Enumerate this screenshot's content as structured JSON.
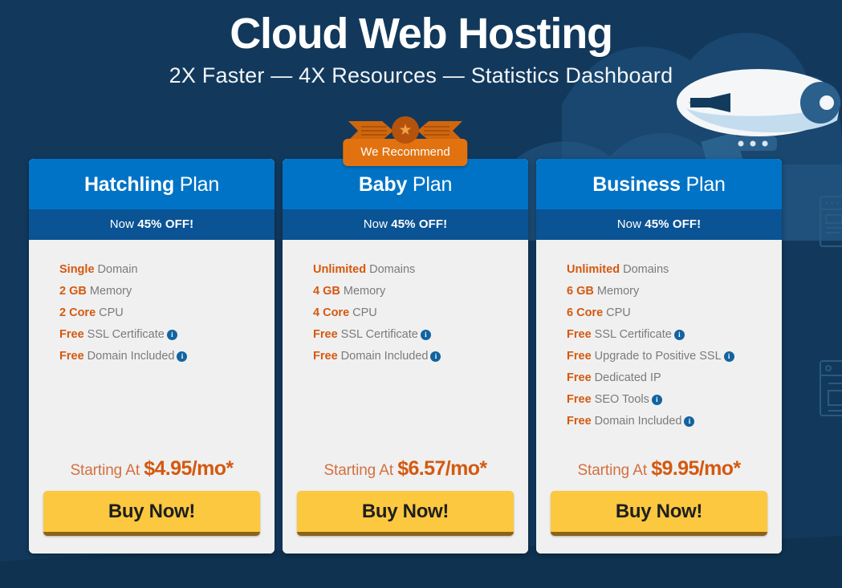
{
  "header": {
    "title": "Cloud Web Hosting",
    "subtitle": "2X Faster — 4X Resources — Statistics Dashboard"
  },
  "colors": {
    "page_background": "#12395c",
    "card_header_blue": "#0073c6",
    "discount_bar_blue": "#0a5394",
    "card_body": "#f0f0f0",
    "accent_orange": "#d4590f",
    "badge_orange": "#e2720f",
    "buy_button_yellow": "#fbc83f",
    "buy_button_shadow": "#8c6315",
    "info_icon_blue": "#1263a0",
    "feature_text_gray": "#7b7b7b"
  },
  "recommend_badge": {
    "label": "We Recommend",
    "star_glyph": "★"
  },
  "info_glyph": "i",
  "plans": [
    {
      "name_bold": "Hatchling",
      "name_rest": " Plan",
      "discount_prefix": "Now ",
      "discount_bold": "45% OFF!",
      "features": [
        {
          "hl": "Single",
          "rest": " Domain",
          "info": false
        },
        {
          "hl": "2 GB",
          "rest": " Memory",
          "info": false
        },
        {
          "hl": "2 Core",
          "rest": " CPU",
          "info": false
        },
        {
          "hl": "Free",
          "rest": " SSL Certificate",
          "info": true
        },
        {
          "hl": "Free",
          "rest": " Domain Included",
          "info": true
        }
      ],
      "price_prefix": "Starting At ",
      "price_amount": "$4.95/mo*",
      "buy_label": "Buy Now!",
      "recommended": false
    },
    {
      "name_bold": "Baby",
      "name_rest": " Plan",
      "discount_prefix": "Now ",
      "discount_bold": "45% OFF!",
      "features": [
        {
          "hl": "Unlimited",
          "rest": " Domains",
          "info": false
        },
        {
          "hl": "4 GB",
          "rest": " Memory",
          "info": false
        },
        {
          "hl": "4 Core",
          "rest": " CPU",
          "info": false
        },
        {
          "hl": "Free",
          "rest": " SSL Certificate",
          "info": true
        },
        {
          "hl": "Free",
          "rest": " Domain Included",
          "info": true
        }
      ],
      "price_prefix": "Starting At ",
      "price_amount": "$6.57/mo*",
      "buy_label": "Buy Now!",
      "recommended": true
    },
    {
      "name_bold": "Business",
      "name_rest": " Plan",
      "discount_prefix": "Now ",
      "discount_bold": "45% OFF!",
      "features": [
        {
          "hl": "Unlimited",
          "rest": " Domains",
          "info": false
        },
        {
          "hl": "6 GB",
          "rest": " Memory",
          "info": false
        },
        {
          "hl": "6 Core",
          "rest": " CPU",
          "info": false
        },
        {
          "hl": "Free",
          "rest": " SSL Certificate",
          "info": true
        },
        {
          "hl": "Free",
          "rest": " Upgrade to Positive SSL",
          "info": true
        },
        {
          "hl": "Free",
          "rest": " Dedicated IP",
          "info": false
        },
        {
          "hl": "Free",
          "rest": " SEO Tools",
          "info": true
        },
        {
          "hl": "Free",
          "rest": " Domain Included",
          "info": true
        }
      ],
      "price_prefix": "Starting At ",
      "price_amount": "$9.95/mo*",
      "buy_label": "Buy Now!",
      "recommended": false
    }
  ],
  "decorations": {
    "airship": "blimp-illustration",
    "clouds": "cloud-shapes",
    "browser_windows": "browser-window-outlines"
  }
}
